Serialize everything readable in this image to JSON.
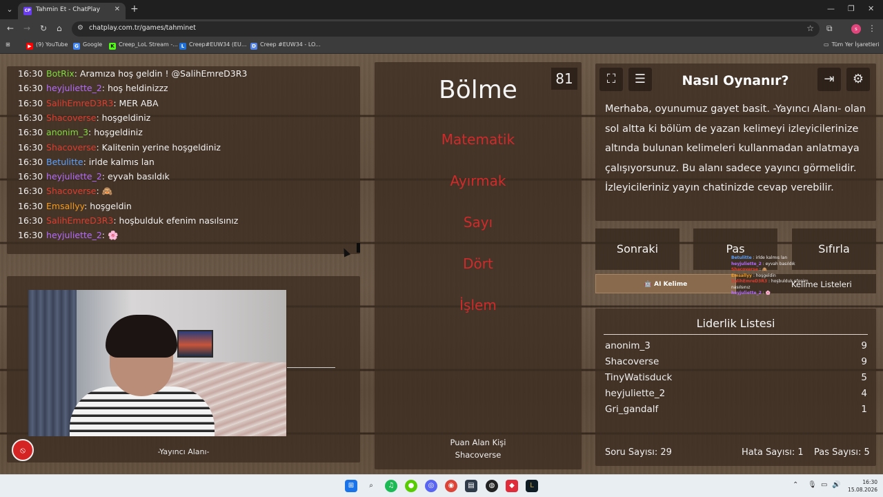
{
  "browser": {
    "tab_title": "Tahmin Et - ChatPlay",
    "tab_favicon": "CP",
    "url": "chatplay.com.tr/games/tahminet",
    "bookmarks": [
      {
        "label": "(9) YouTube",
        "icon": "youtube-icon",
        "color": "#ff0000"
      },
      {
        "label": "Google",
        "icon": "google-icon",
        "color": "#4285f4"
      },
      {
        "label": "Creep_LoL Stream -...",
        "icon": "kick-icon",
        "color": "#53fc18"
      },
      {
        "label": "Creep#EUW34 (EU...",
        "icon": "lol-icon",
        "color": "#1e6fd9"
      },
      {
        "label": "Creep #EUW34 - LO...",
        "icon": "op-icon",
        "color": "#5383e8"
      }
    ],
    "all_bookmarks_label": "Tüm Yer İşaretleri",
    "profile_initial": "s"
  },
  "chat": {
    "messages": [
      {
        "time": "16:30",
        "user": "BotRix",
        "color": "#7ddc3c",
        "text": ": Aramıza hoş geldin ! @SalihEmreD3R3"
      },
      {
        "time": "16:30",
        "user": "heyjuliette_2",
        "color": "#b56bff",
        "text": ": hoş heldinizzz"
      },
      {
        "time": "16:30",
        "user": "SalihEmreD3R3",
        "color": "#e03b2d",
        "text": ": MER ABA"
      },
      {
        "time": "16:30",
        "user": "Shacoverse",
        "color": "#e03b2d",
        "text": ": hoşgeldiniz"
      },
      {
        "time": "16:30",
        "user": "anonim_3",
        "color": "#7ddc3c",
        "text": ": hoşgeldiniz"
      },
      {
        "time": "16:30",
        "user": "Shacoverse",
        "color": "#e03b2d",
        "text": ": Kalitenin yerine hoşgeldiniz"
      },
      {
        "time": "16:30",
        "user": "Betulitte",
        "color": "#5aa0ff",
        "text": ": irlde kalmıs lan"
      },
      {
        "time": "16:30",
        "user": "heyjuliette_2",
        "color": "#b56bff",
        "text": ": eyvah basıldık"
      },
      {
        "time": "16:30",
        "user": "Shacoverse",
        "color": "#e03b2d",
        "text": ": 🙈"
      },
      {
        "time": "16:30",
        "user": "Emsallyy",
        "color": "#f39a1e",
        "text": ": hoşgeldin"
      },
      {
        "time": "16:30",
        "user": "SalihEmreD3R3",
        "color": "#e03b2d",
        "text": ": hoşbulduk efenim nasılsınız"
      },
      {
        "time": "16:30",
        "user": "heyjuliette_2",
        "color": "#b56bff",
        "text": ": 🌸"
      }
    ]
  },
  "streamer": {
    "label": "-Yayıncı Alanı-"
  },
  "word_card": {
    "timer": "81",
    "word": "Bölme",
    "forbidden_words": [
      "Matematik",
      "Ayırmak",
      "Sayı",
      "Dört",
      "İşlem"
    ],
    "scorer_label": "Puan Alan Kişi",
    "scorer_name": "Shacoverse"
  },
  "howto": {
    "title": "Nasıl Oynanır?",
    "text": "Merhaba, oyunumuz gayet basit. -Yayıncı Alanı- olan sol altta ki bölüm de yazan kelimeyi izleyicilerinize altında bulunan kelimeleri kullanmadan anlatmaya çalışıyorsunuz. Bu alanı sadece yayıncı görmelidir. İzleyicileriniz yayın chatinizde cevap verebilir."
  },
  "actions": {
    "next": "Sonraki",
    "pass": "Pas",
    "reset": "Sıfırla",
    "ai_word": "🤖 AI Kelime",
    "word_lists": "Kelime Listeleri"
  },
  "overlay_chat": [
    {
      "user": "Betulitte",
      "color": "#5aa0ff",
      "text": " : irlde kalmıs lan"
    },
    {
      "user": "heyjuliette_2",
      "color": "#b56bff",
      "text": " : eyvah basıldık"
    },
    {
      "user": "Shacoverse",
      "color": "#e03b2d",
      "text": " : 🙈"
    },
    {
      "user": "Emsallyy",
      "color": "#f39a1e",
      "text": " : hoşgeldin"
    },
    {
      "user": "SalihEmreD3R3",
      "color": "#e03b2d",
      "text": " : hoşbulduk efenim nasılsınız"
    },
    {
      "user": "heyjuliette_2",
      "color": "#b56bff",
      "text": " : 🌸"
    }
  ],
  "leaderboard": {
    "title": "Liderlik Listesi",
    "rows": [
      {
        "name": "anonim_3",
        "score": "9"
      },
      {
        "name": "Shacoverse",
        "score": "9"
      },
      {
        "name": "TinyWatisduck",
        "score": "5"
      },
      {
        "name": "heyjuliette_2",
        "score": "4"
      },
      {
        "name": "Gri_gandalf",
        "score": "1"
      }
    ]
  },
  "stats": {
    "questions": "Soru Sayısı: 29",
    "errors": "Hata Sayısı: 1",
    "passes": "Pas Sayısı: 5"
  },
  "taskbar": {
    "time": "16:30",
    "date": "15.08.2026"
  }
}
